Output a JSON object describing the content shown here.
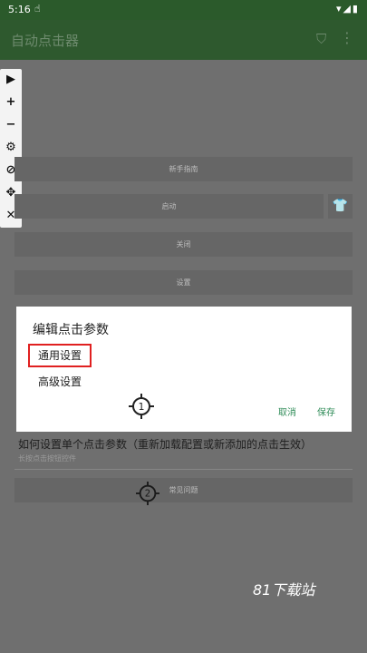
{
  "status_bar": {
    "time": "5:16",
    "icons": "▾◢▮"
  },
  "app_bar": {
    "title": "自动点击器"
  },
  "float_toolbar": [
    {
      "name": "play",
      "glyph": "▶"
    },
    {
      "name": "plus",
      "glyph": "+"
    },
    {
      "name": "minus",
      "glyph": "−"
    },
    {
      "name": "settings",
      "glyph": "⚙"
    },
    {
      "name": "hide",
      "glyph": "⊘"
    },
    {
      "name": "move",
      "glyph": "✥"
    },
    {
      "name": "close",
      "glyph": "✕"
    }
  ],
  "main": {
    "guide": "新手指南",
    "start": "启动",
    "close": "关闭",
    "settings": "设置",
    "faq": "常见问题"
  },
  "dialog": {
    "title": "编辑点击参数",
    "tab_general": "通用设置",
    "tab_advanced": "高级设置",
    "target_number": "1",
    "cancel": "取消",
    "save": "保存"
  },
  "info": {
    "heading": "如何设置单个点击参数（重新加载配置或新添加的点击生效）",
    "sub": "长按点击按钮控件"
  },
  "target2_number": "2",
  "watermark": "81下载站"
}
